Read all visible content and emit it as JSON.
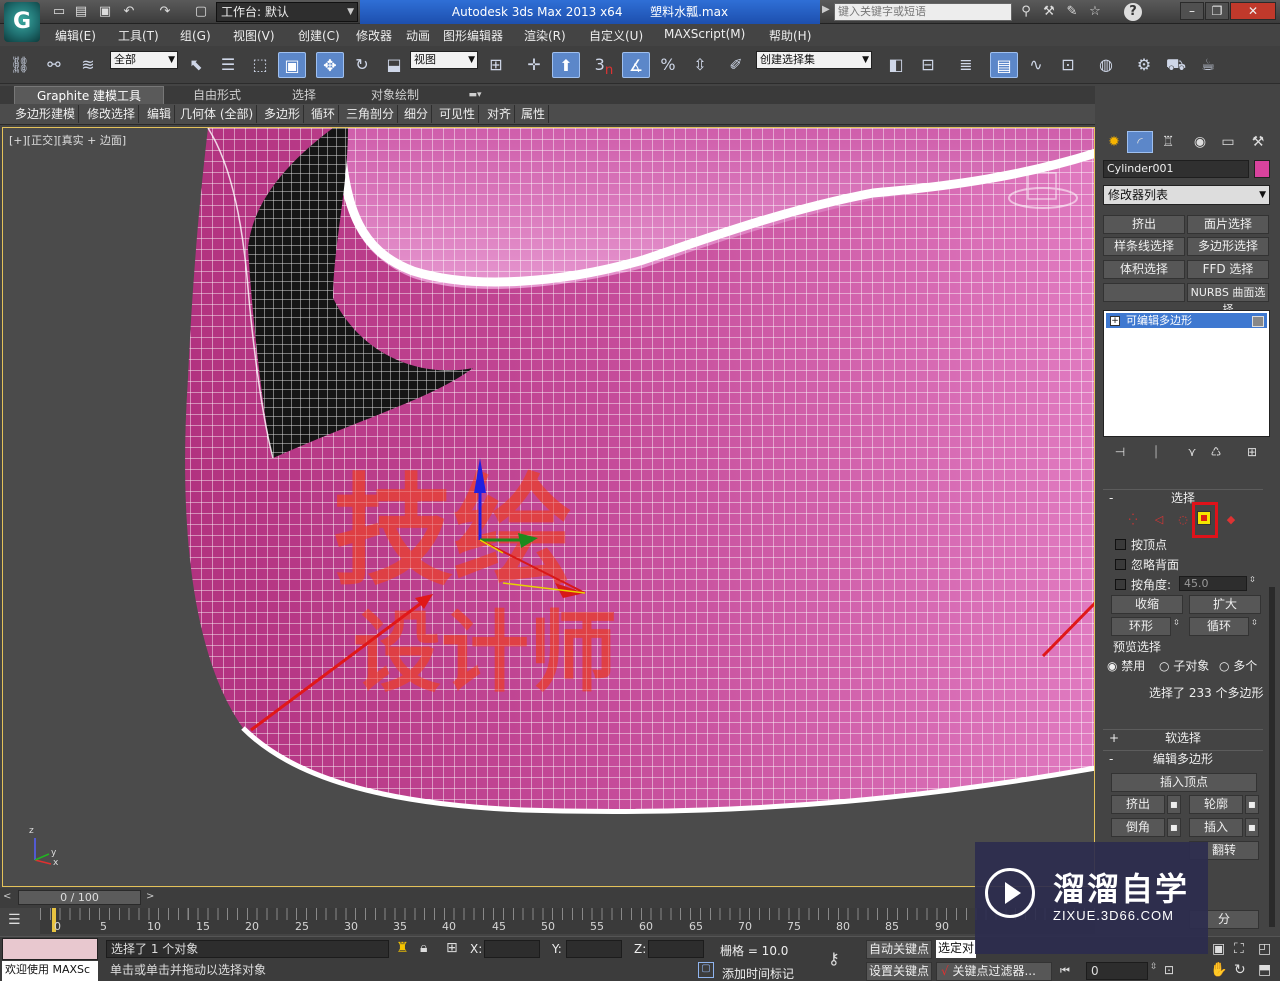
{
  "titlebar": {
    "workspace": "工作台: 默认",
    "app_title": "Autodesk 3ds Max  2013 x64",
    "file_name": "塑料水瓢.max",
    "search_placeholder": "键入关键字或短语",
    "help": "?"
  },
  "menu": [
    "编辑(E)",
    "工具(T)",
    "组(G)",
    "视图(V)",
    "创建(C)",
    "修改器",
    "动画",
    "图形编辑器",
    "渲染(R)",
    "自定义(U)",
    "MAXScript(M)",
    "帮助(H)"
  ],
  "toolbar": {
    "selection_filter": "全部",
    "ref_coord": "视图",
    "snap_num": "3",
    "named_selection": "创建选择集"
  },
  "ribbon": {
    "tabs": [
      "Graphite 建模工具",
      "自由形式",
      "选择",
      "对象绘制"
    ],
    "commands": [
      "多边形建模",
      "修改选择",
      "编辑",
      "几何体 (全部)",
      "多边形",
      "循环",
      "三角剖分",
      "细分",
      "可见性",
      "对齐",
      "属性"
    ]
  },
  "viewport": {
    "label": "[+][正交][真实 + 边面]",
    "axis": {
      "z": "z",
      "x": "x",
      "y": "y"
    },
    "overlay_text": {
      "line1": "技绘",
      "line2": "设计师"
    },
    "colors": {
      "mesh": "#c23d96",
      "mesh_light": "#e46fbd",
      "wire": "#ffffff",
      "text_overlay": "#e2403f",
      "arrow": "#e01818"
    }
  },
  "command_panel": {
    "object_name": "Cylinder001",
    "modifier_list": "修改器列表",
    "modifier_buttons": [
      "挤出",
      "面片选择",
      "样条线选择",
      "多边形选择",
      "体积选择",
      "FFD 选择",
      "",
      "NURBS 曲面选择"
    ],
    "stack_item": "可编辑多边形",
    "selection": {
      "title": "选择",
      "by_vertex": "按顶点",
      "ignore_backfacing": "忽略背面",
      "by_angle": "按角度:",
      "angle_value": "45.0",
      "shrink": "收缩",
      "grow": "扩大",
      "ring": "环形",
      "loop": "循环",
      "preview_title": "预览选择",
      "preview_disabled": "禁用",
      "preview_subobject": "子对象",
      "preview_multi": "多个",
      "status": "选择了 233 个多边形"
    },
    "soft_selection": "软选择",
    "edit_polygons": {
      "title": "编辑多边形",
      "insert_vertex": "插入顶点",
      "extrude": "挤出",
      "outline": "轮廓",
      "bevel": "倒角",
      "inset": "插入",
      "flip": "翻转",
      "partial": "分"
    }
  },
  "timeline": {
    "frame_display": "0 / 100",
    "ticks": [
      "0",
      "5",
      "10",
      "15",
      "20",
      "25",
      "30",
      "35",
      "40",
      "45",
      "50",
      "55",
      "60",
      "65",
      "70",
      "75",
      "80",
      "85",
      "90"
    ]
  },
  "status": {
    "maxscript_hint": "欢迎使用 MAXSc",
    "selected": "选择了 1 个对象",
    "prompt": "单击或单击并拖动以选择对象",
    "x_label": "X:",
    "y_label": "Y:",
    "z_label": "Z:",
    "grid": "栅格 = 10.0",
    "auto_key": "自动关键点",
    "selected_obj": "选定对",
    "set_key": "设置关键点",
    "key_filter": "关键点过滤器...",
    "add_time_tag": "添加时间标记",
    "frame": "0"
  },
  "watermark": {
    "title": "溜溜自学",
    "url": "ZIXUE.3D66.COM"
  }
}
